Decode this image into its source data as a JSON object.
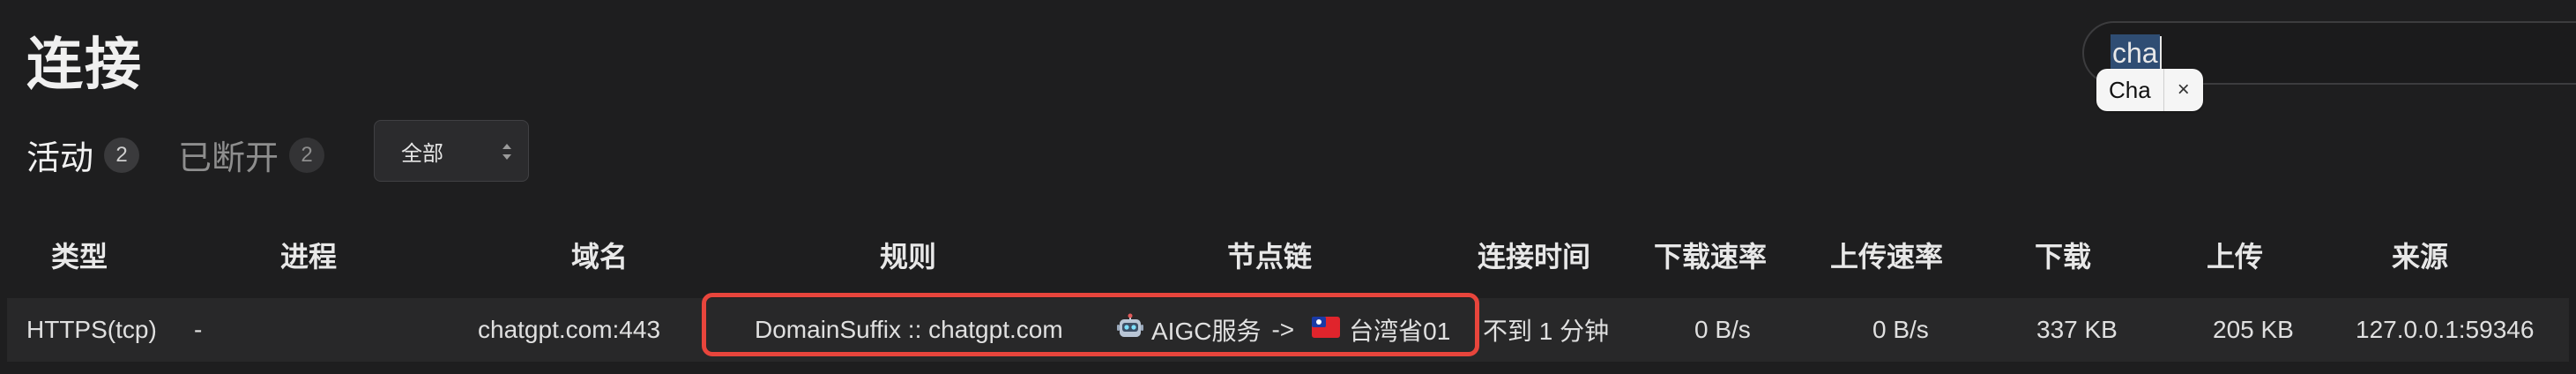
{
  "page": {
    "title": "连接"
  },
  "search": {
    "value": "cha",
    "chip_label": "Cha",
    "chip_close": "×"
  },
  "tabs": [
    {
      "label": "活动",
      "count": "2",
      "active": true
    },
    {
      "label": "已断开",
      "count": "2",
      "active": false
    }
  ],
  "filter": {
    "selected": "全部"
  },
  "table": {
    "headers": [
      "类型",
      "进程",
      "域名",
      "规则",
      "节点链",
      "连接时间",
      "下载速率",
      "上传速率",
      "下载",
      "上传",
      "来源"
    ],
    "rows": [
      {
        "type": "HTTPS(tcp)",
        "process": "-",
        "host": "chatgpt.com:443",
        "rule": "DomainSuffix :: chatgpt.com",
        "chain_group": "AIGC服务",
        "chain_arrow": "->",
        "chain_node": "台湾省01",
        "time": "不到 1 分钟",
        "dl_speed": "0 B/s",
        "ul_speed": "0 B/s",
        "download": "337 KB",
        "upload": "205 KB",
        "source": "127.0.0.1:59346"
      }
    ]
  },
  "icons": {
    "chain_group_icon": "robot-icon",
    "chain_node_icon": "flag-icon"
  },
  "colors": {
    "background": "#1e1e1f",
    "row": "#282829",
    "highlight": "#e8453c",
    "search_selection": "#2f4d73"
  }
}
